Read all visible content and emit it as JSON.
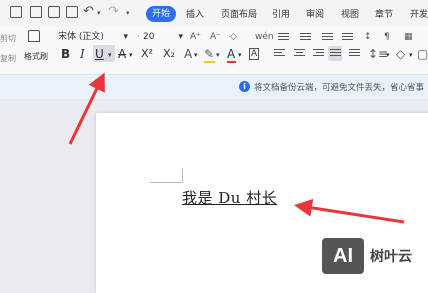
{
  "menubar": {
    "tabs": [
      "开始",
      "插入",
      "页面布局",
      "引用",
      "审阅",
      "视图",
      "章节",
      "开发"
    ],
    "active_tab": "开始"
  },
  "ribbon": {
    "cut_label": "剪切",
    "copy_label": "复制",
    "format_painter_label": "格式刷",
    "font_name": "宋体 (正文)",
    "font_size": "20",
    "bold": "B",
    "italic": "I",
    "underline": "U",
    "superscript": "X²",
    "subscript": "X₂",
    "font_color": "A",
    "char_border": "A"
  },
  "notice": {
    "text": "将文档备份云端，可避免文件丢失，省心省事"
  },
  "document": {
    "text": "我是 Du 村长"
  },
  "watermark": {
    "logo": "AI",
    "name": "树叶云"
  },
  "colors": {
    "accent": "#2f6df5",
    "arrow": "#e8363a"
  }
}
